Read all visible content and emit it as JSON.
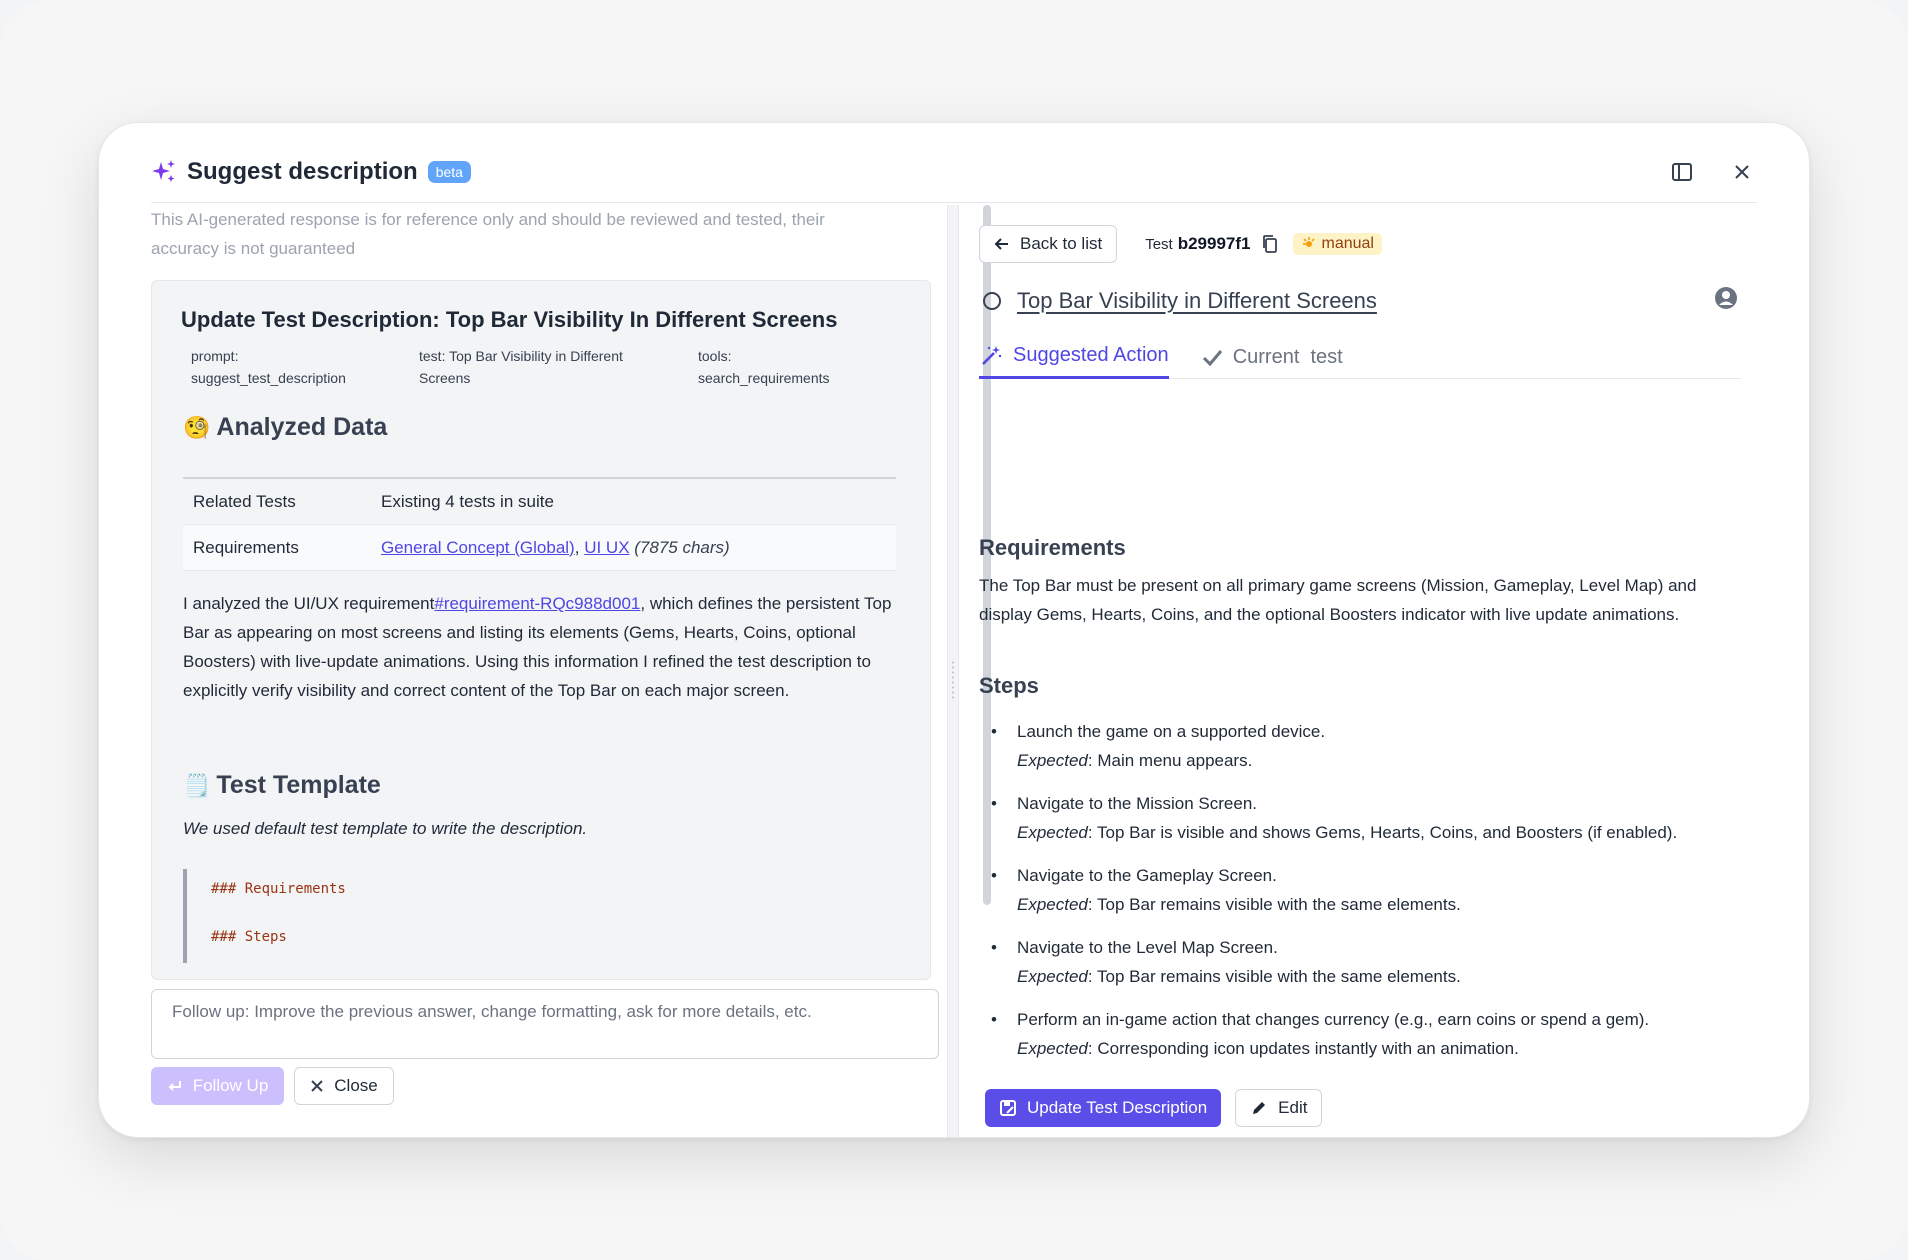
{
  "header": {
    "title": "Suggest description",
    "badge": "beta"
  },
  "left": {
    "disclaimer": "This AI-generated response is for reference only and should be reviewed and tested, their accuracy is not guaranteed",
    "card_title": "Update Test Description: Top Bar Visibility In Different Screens",
    "meta": {
      "prompt": "prompt:\nsuggest_test_description",
      "test": "test: Top Bar Visibility in Different\nScreens",
      "tools": "tools:\nsearch_requirements"
    },
    "analyzed_heading": "Analyzed Data",
    "analyzed_emoji": "🧐",
    "table": {
      "row1_key": "Related Tests",
      "row1_val": "Existing 4 tests in suite",
      "row2_key": "Requirements",
      "link1": "General Concept (Global)",
      "comma": ",",
      "link2": "UI UX",
      "chars": "(7875 chars)"
    },
    "analysis_prefix": "I analyzed the UI/UX requirement",
    "analysis_link": "#requirement-RQc988d001",
    "analysis_suffix": ", which defines the persistent Top Bar as appearing on most screens and listing its elements (Gems, Hearts, Coins, optional Boosters) with live-update animations. Using this information I refined the test description to explicitly verify visibility and correct content of the Top Bar on each major screen.",
    "template_heading": "Test Template",
    "template_emoji": "🗒️",
    "template_note": "We used default test template to write the description.",
    "code_lines": [
      "### Requirements",
      "### Steps"
    ],
    "followup_placeholder": "Follow up: Improve the previous answer, change formatting, ask for more details, etc.",
    "followup_label": "Follow Up",
    "close_label": "Close"
  },
  "right": {
    "back_label": "Back to list",
    "test_label": "Test",
    "test_id": "b29997f1",
    "manual_badge": "manual",
    "test_title": "Top Bar Visibility in Different Screens",
    "tabs": [
      "Suggested Action",
      "Current  test"
    ],
    "requirements_heading": "Requirements",
    "requirements_text": "The Top Bar must be present on all primary game screens (Mission, Gameplay, Level Map) and display Gems, Hearts, Coins, and the optional Boosters indicator with live update animations.",
    "steps_heading": "Steps",
    "expected_label": "Expected",
    "steps": [
      {
        "action": "Launch the game on a supported device.",
        "expected": ": Main menu appears."
      },
      {
        "action": "Navigate to the Mission Screen.",
        "expected": ": Top Bar is visible and shows Gems, Hearts, Coins, and Boosters (if enabled)."
      },
      {
        "action": "Navigate to the Gameplay Screen.",
        "expected": ": Top Bar remains visible with the same elements."
      },
      {
        "action": "Navigate to the Level Map Screen.",
        "expected": ": Top Bar remains visible with the same elements."
      },
      {
        "action": "Perform an in-game action that changes currency (e.g., earn coins or spend a gem).",
        "expected": ": Corresponding icon updates instantly with an animation."
      }
    ],
    "update_label": "Update Test Description",
    "edit_label": "Edit"
  },
  "colors": {
    "accent": "#4f46e5",
    "beta": "#60a5fa",
    "manual_bg": "#fef3c7"
  }
}
